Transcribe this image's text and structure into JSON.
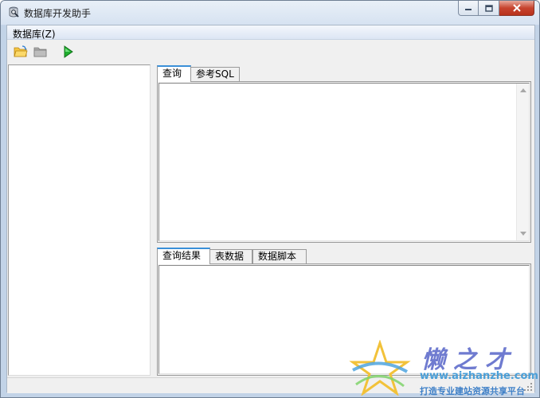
{
  "window": {
    "title": "数据库开发助手",
    "menu": {
      "database_label": "数据库(Z)"
    },
    "toolbar": {
      "icons": [
        "open-folder-icon",
        "folder-icon",
        "run-icon"
      ]
    },
    "query_tabs": [
      "查询",
      "参考SQL"
    ],
    "result_tabs": [
      "查询结果",
      "表数据",
      "数据脚本"
    ]
  },
  "watermark": {
    "title": "懒之才",
    "url": "www.aizhanzhe.com",
    "slogan": "打造专业建站资源共享平台"
  },
  "colors": {
    "title_bar": "#dbe6f3",
    "close_button": "#c7442f",
    "tab_accent": "#3a8fd8",
    "client_bg": "#f0f0f0"
  }
}
